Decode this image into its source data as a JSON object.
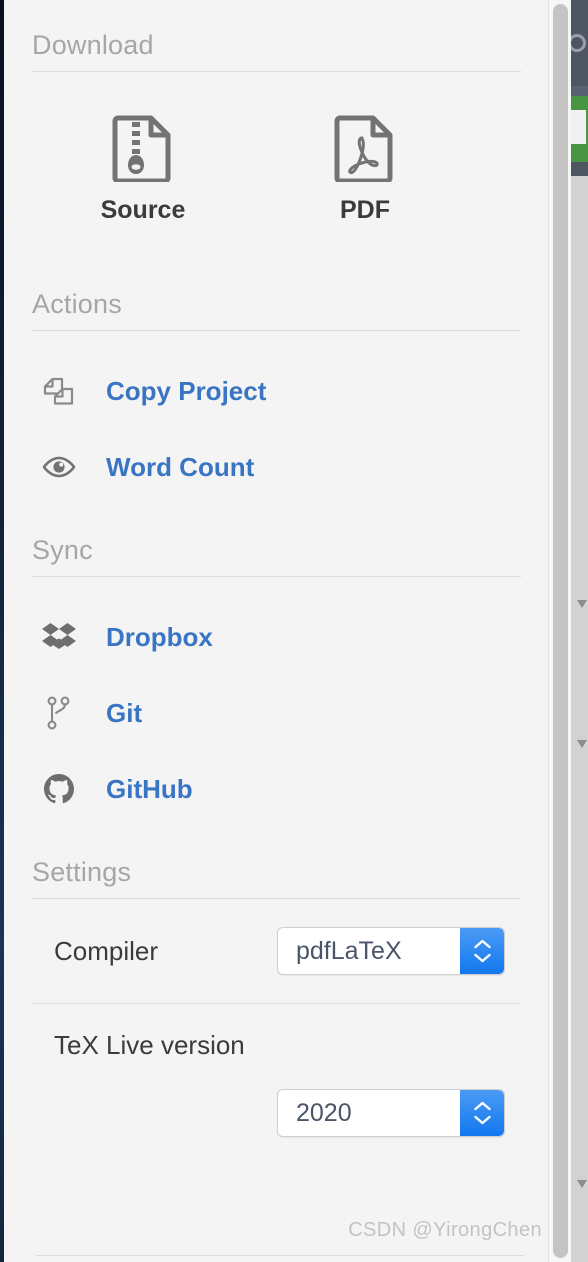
{
  "panel": {
    "sections": [
      {
        "id": "download",
        "title": "Download",
        "items": [
          {
            "id": "source",
            "label": "Source",
            "icon": "file-archive-icon"
          },
          {
            "id": "pdf",
            "label": "PDF",
            "icon": "file-pdf-icon"
          }
        ]
      },
      {
        "id": "actions",
        "title": "Actions",
        "items": [
          {
            "id": "copy-project",
            "label": "Copy Project",
            "icon": "copy-icon"
          },
          {
            "id": "word-count",
            "label": "Word Count",
            "icon": "eye-icon"
          }
        ]
      },
      {
        "id": "sync",
        "title": "Sync",
        "items": [
          {
            "id": "dropbox",
            "label": "Dropbox",
            "icon": "dropbox-icon"
          },
          {
            "id": "git",
            "label": "Git",
            "icon": "git-branch-icon"
          },
          {
            "id": "github",
            "label": "GitHub",
            "icon": "github-icon"
          }
        ]
      },
      {
        "id": "settings",
        "title": "Settings",
        "rows": [
          {
            "id": "compiler",
            "label": "Compiler",
            "value": "pdfLaTeX"
          },
          {
            "id": "texlive",
            "label": "TeX Live version",
            "value": "2020"
          }
        ]
      }
    ]
  },
  "watermark": "CSDN @YirongChen",
  "colors": {
    "panel_bg": "#f4f4f4",
    "link_blue": "#3a75c4",
    "heading_gray": "#a6a6a6",
    "text_dark": "#3b3b3b",
    "icon_gray": "#737373",
    "stepper_blue": "#1278ef",
    "select_text": "#4a5568",
    "rule": "#dcdcdc",
    "scrollbar_thumb": "#c4c4c4",
    "left_edge_navy": "#13213a",
    "bg_toolbar": "#4e5563",
    "bg_green": "#4a9544"
  }
}
